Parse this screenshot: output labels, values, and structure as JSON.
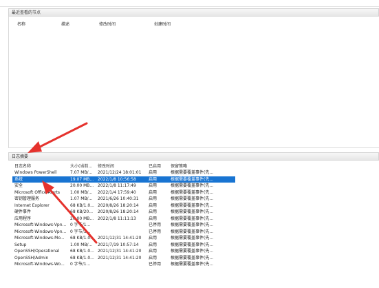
{
  "recent_nodes": {
    "title": "最近查看的节点",
    "columns": [
      "名称",
      "描述",
      "修改时间",
      "创建时间"
    ]
  },
  "log_summary": {
    "title": "日志摘要",
    "columns": [
      "日志名称",
      "大小(当前...",
      "修改时间",
      "已启用",
      "保留策略"
    ],
    "rows": [
      [
        "Windows PowerShell",
        "7.07 MB/...",
        "2021/12/24 18:01:01",
        "启用",
        "根据需要覆盖事件(先..."
      ],
      [
        "系统",
        "19.07 MB...",
        "2022/1/8 10:56:58",
        "启用",
        "根据需要覆盖事件(先..."
      ],
      [
        "安全",
        "20.00 MB...",
        "2022/1/8 11:17:49",
        "启用",
        "根据需要覆盖事件(先..."
      ],
      [
        "Microsoft Office Alerts",
        "1.00 MB/...",
        "2022/1/4 17:59:40",
        "启用",
        "根据需要覆盖事件(先..."
      ],
      [
        "密钥管理服务",
        "1.07 MB/...",
        "2021/6/26 10:40:31",
        "启用",
        "根据需要覆盖事件(先..."
      ],
      [
        "Internet Explorer",
        "68 KB/1.0...",
        "2020/8/26 18:20:14",
        "启用",
        "根据需要覆盖事件(先..."
      ],
      [
        "硬件事件",
        "68 KB/20...",
        "2020/8/26 18:20:14",
        "启用",
        "根据需要覆盖事件(先..."
      ],
      [
        "应用程序",
        "20.00 MB...",
        "2022/1/8 11:11:13",
        "启用",
        "根据需要覆盖事件(先..."
      ],
      [
        "Microsoft-Windows-Vpn...",
        "0 字节/1...",
        "",
        "已停用",
        "根据需要覆盖事件(先..."
      ],
      [
        "Microsoft-Windows-Vpn...",
        "0 字节/1...",
        "",
        "已停用",
        "根据需要覆盖事件(先..."
      ],
      [
        "Microsoft-Windows-Mo...",
        "68 KB/1.0...",
        "2021/12/31 14:41:20",
        "启用",
        "根据需要覆盖事件(先..."
      ],
      [
        "Setup",
        "1.00 MB/...",
        "2021/7/19 10:57:14",
        "启用",
        "根据需要覆盖事件(先..."
      ],
      [
        "OpenSSH/Operational",
        "68 KB/1.0...",
        "2021/12/31 14:41:20",
        "启用",
        "根据需要覆盖事件(先..."
      ],
      [
        "OpenSSH/Admin",
        "68 KB/1.0...",
        "2021/12/31 14:41:20",
        "启用",
        "根据需要覆盖事件(先..."
      ],
      [
        "Microsoft-Windows-Wo...",
        "0 字节/1...",
        "",
        "已停用",
        "根据需要覆盖事件(先..."
      ]
    ],
    "selected_row": 1
  },
  "colors": {
    "selection": "#1874d2",
    "annotation_arrow": "#e5322d"
  }
}
